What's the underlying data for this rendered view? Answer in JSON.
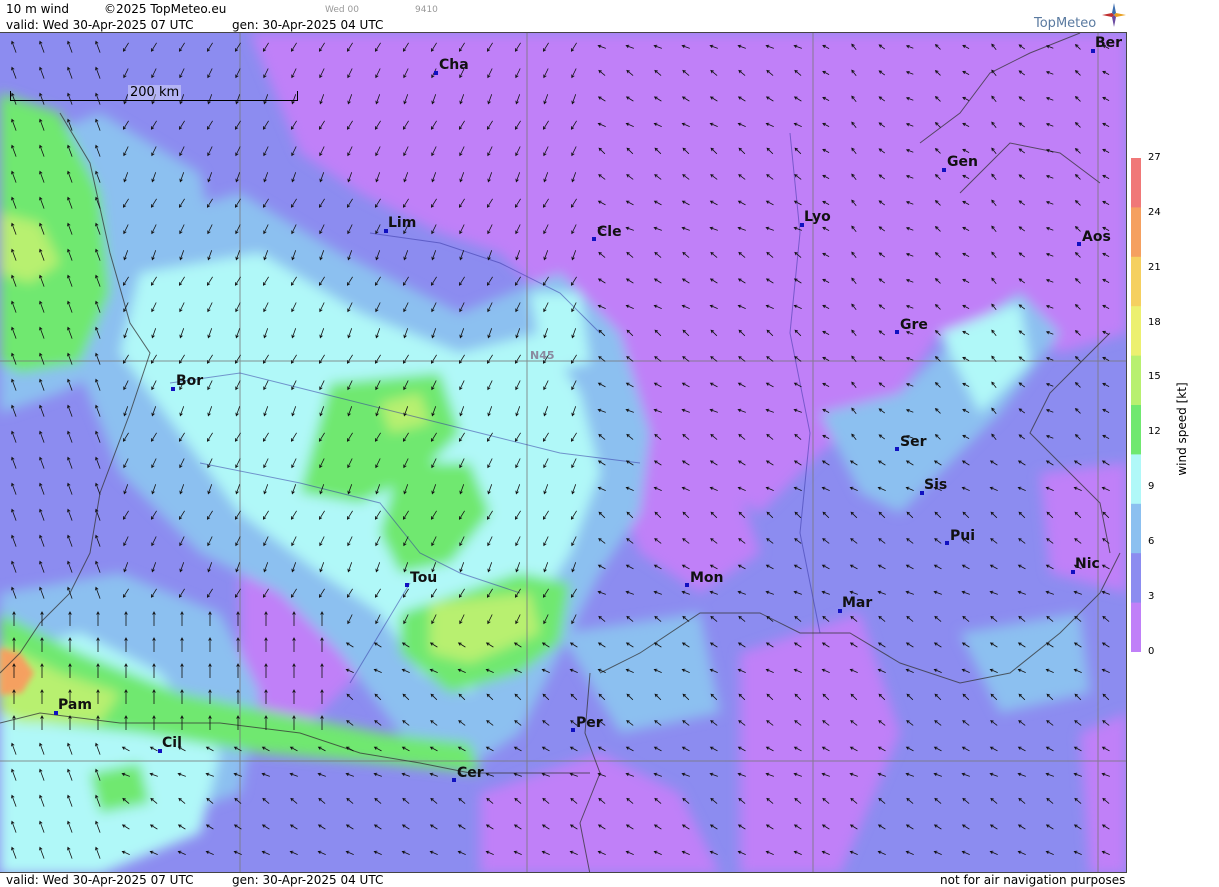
{
  "header": {
    "product": "10 m wind",
    "copyright": "©2025 TopMeteo.eu",
    "valid": "valid:  Wed  30-Apr-2025  07 UTC",
    "gen": "gen: 30-Apr-2025 04 UTC",
    "small_day": "Wed 00",
    "small_code": "9410",
    "brand": "TopMeteo"
  },
  "map": {
    "scale_label": "200 km",
    "grid_label": "N45",
    "cities": [
      {
        "name": "Cha"
      },
      {
        "name": "Ber"
      },
      {
        "name": "Gen"
      },
      {
        "name": "Lim"
      },
      {
        "name": "Cle"
      },
      {
        "name": "Lyo"
      },
      {
        "name": "Aos"
      },
      {
        "name": "Gre"
      },
      {
        "name": "Bor"
      },
      {
        "name": "Ser"
      },
      {
        "name": "Sis"
      },
      {
        "name": "Pui"
      },
      {
        "name": "Nic"
      },
      {
        "name": "Tou"
      },
      {
        "name": "Mon"
      },
      {
        "name": "Mar"
      },
      {
        "name": "Pam"
      },
      {
        "name": "Per"
      },
      {
        "name": "Cil"
      },
      {
        "name": "Cer"
      }
    ]
  },
  "legend": {
    "title": "wind speed [kt]",
    "ticks": [
      "27",
      "24",
      "21",
      "18",
      "15",
      "12",
      "9",
      "6",
      "3",
      "0"
    ],
    "colors": [
      "#f07878",
      "#f5a060",
      "#f5d060",
      "#ecf070",
      "#b8f070",
      "#70e870",
      "#b0f8f8",
      "#8cc0f0",
      "#8c8cf0",
      "#c080f8"
    ]
  },
  "footer": {
    "valid": "valid:  Wed  30-Apr-2025  07 UTC",
    "gen": "gen: 30-Apr-2025 04 UTC",
    "disclaimer": "not for air navigation purposes"
  }
}
